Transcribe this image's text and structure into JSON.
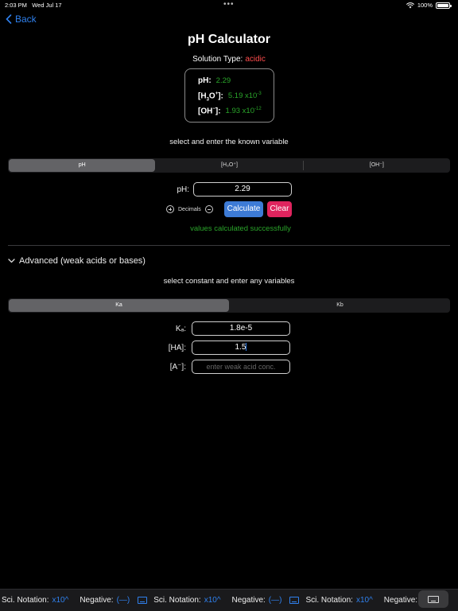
{
  "status": {
    "time": "2:03 PM",
    "date": "Wed Jul 17",
    "battery": "100%"
  },
  "nav": {
    "back_label": "Back"
  },
  "title": "pH Calculator",
  "solution": {
    "label": "Solution Type:",
    "value": "acidic"
  },
  "results": {
    "ph_label": "pH:",
    "ph_value": "2.29",
    "h3o_value": "5.19 x10",
    "h3o_exp": "-3",
    "oh_value": "1.93 x10",
    "oh_exp": "-12"
  },
  "known": {
    "prompt": "select and enter the known variable",
    "tabs": [
      "pH",
      "[H₃O⁺]",
      "[OH⁻]"
    ],
    "active_tab": "pH",
    "input_label": "pH:",
    "input_value": "2.29",
    "decimals_label": "Decimals",
    "calculate_label": "Calculate",
    "clear_label": "Clear",
    "message": "values calculated successfully"
  },
  "advanced": {
    "header": "Advanced (weak acids or bases)",
    "prompt": "select constant and enter any variables",
    "tabs": [
      "Ka",
      "Kb"
    ],
    "active_tab": "Ka",
    "ka_label": "Kₐ:",
    "ka_value": "1.8e-5",
    "ha_label": "[HA]:",
    "ha_value": "1.5",
    "a_label": "[A⁻]:",
    "a_placeholder": "enter weak acid conc."
  },
  "keyboard_bar": {
    "sci_label": "Sci. Notation:",
    "sci_key": "x10^",
    "neg_label": "Negative:",
    "neg_key": "(—)"
  },
  "colors": {
    "accent": "#2f80ed",
    "success": "#2aa52a",
    "danger": "#e0245e",
    "acidic": "#ff4d4d"
  }
}
